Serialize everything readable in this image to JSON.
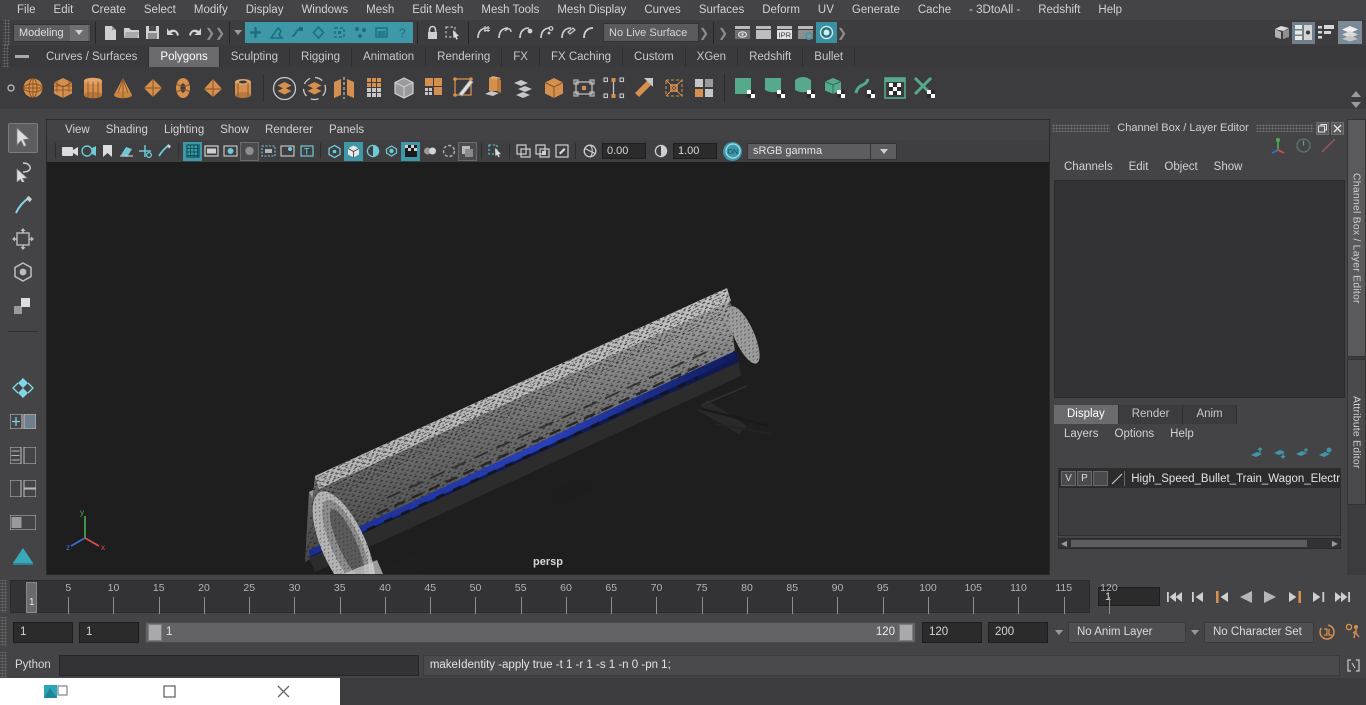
{
  "menubar": {
    "items": [
      "File",
      "Edit",
      "Create",
      "Select",
      "Modify",
      "Display",
      "Windows",
      "Mesh",
      "Edit Mesh",
      "Mesh Tools",
      "Mesh Display",
      "Curves",
      "Surfaces",
      "Deform",
      "UV",
      "Generate",
      "Cache",
      "- 3DtoAll -",
      "Redshift",
      "Help"
    ]
  },
  "status": {
    "menuset": "Modeling",
    "live_surface": "No Live Surface"
  },
  "shelf": {
    "tabs": [
      "Curves / Surfaces",
      "Polygons",
      "Sculpting",
      "Rigging",
      "Animation",
      "Rendering",
      "FX",
      "FX Caching",
      "Custom",
      "XGen",
      "Redshift",
      "Bullet"
    ],
    "active_tab": "Polygons"
  },
  "viewport": {
    "menus": [
      "View",
      "Shading",
      "Lighting",
      "Show",
      "Renderer",
      "Panels"
    ],
    "exposure": "0.00",
    "gamma": "1.00",
    "color_space": "sRGB gamma",
    "camera_label": "persp",
    "axis": {
      "x": "x",
      "y": "y",
      "z": "z"
    }
  },
  "right_panel": {
    "title": "Channel Box / Layer Editor",
    "channel_menus": [
      "Channels",
      "Edit",
      "Object",
      "Show"
    ],
    "layer_tabs": [
      "Display",
      "Render",
      "Anim"
    ],
    "active_layer_tab": "Display",
    "layer_menus": [
      "Layers",
      "Options",
      "Help"
    ],
    "layers": [
      {
        "visibility": "V",
        "playback": "P",
        "shading": "",
        "name": "High_Speed_Bullet_Train_Wagon_Electric_D"
      }
    ],
    "vertical_tabs": [
      "Channel Box / Layer Editor",
      "Attribute Editor"
    ]
  },
  "timeline": {
    "ticks": [
      5,
      10,
      15,
      20,
      25,
      30,
      35,
      40,
      45,
      50,
      55,
      60,
      65,
      70,
      75,
      80,
      85,
      90,
      95,
      100,
      105,
      110,
      115,
      120
    ],
    "current_frame": "1",
    "current_frame_field": "1"
  },
  "range": {
    "start": "1",
    "start2": "1",
    "slider_min": "1",
    "slider_max": "120",
    "anim_end": "120",
    "range_end": "200",
    "anim_layer": "No Anim Layer",
    "character_set": "No Character Set"
  },
  "command_line": {
    "language": "Python",
    "input_value": "",
    "result": "makeIdentity -apply true -t 1 -r 1 -s 1 -n 0 -pn 1;"
  },
  "colors": {
    "accent_teal": "#3e98a8",
    "shelf_orange": "#d58f4e",
    "shelf_green": "#56a98a",
    "bg": "#444446",
    "viewport_bg": "#1e1e1e"
  },
  "icons": {
    "new_scene": "new-scene-icon",
    "open_scene": "open-scene-icon",
    "save_scene": "save-scene-icon",
    "undo": "undo-icon",
    "redo": "redo-icon",
    "lock": "lock-icon",
    "selection_mask": "selection-mask-icon",
    "snap_grid": "snap-to-grid-icon",
    "snap_curve": "snap-to-curve-icon",
    "snap_point": "snap-to-point-icon",
    "snap_projected": "snap-to-projected-center-icon",
    "snap_view_plane": "snap-to-view-plane-icon",
    "make_live": "make-live-icon",
    "render_view": "render-view-icon",
    "render_sequence": "render-sequence-icon",
    "ipr": "ipr-render-icon",
    "render_settings": "render-settings-icon",
    "hypershade": "hypershade-icon",
    "show_hide_modeling_toolkit": "modeling-toolkit-icon",
    "attribute_editor": "attribute-editor-icon",
    "tool_settings": "tool-settings-icon",
    "channel_box": "channel-box-icon"
  }
}
